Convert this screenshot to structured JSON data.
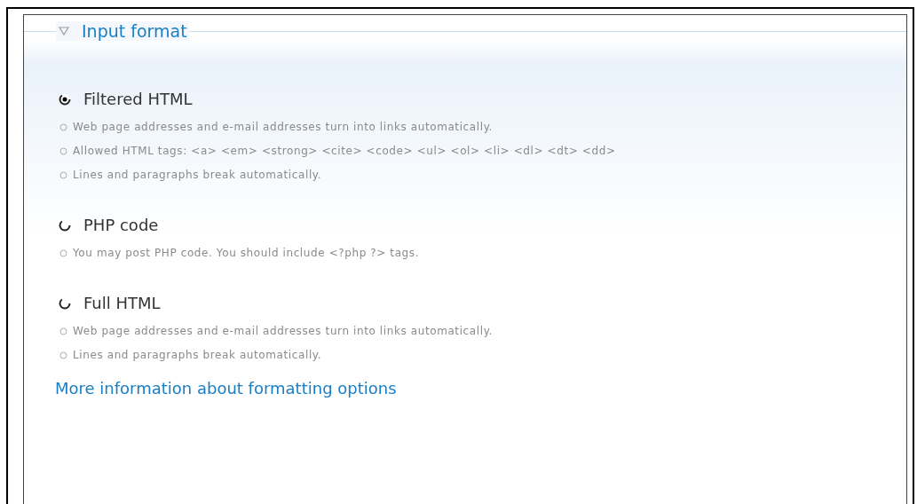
{
  "fieldset": {
    "legend": "Input format",
    "expanded": true
  },
  "formats": [
    {
      "label": "Filtered HTML",
      "selected": true,
      "tips": [
        "Web page addresses and e-mail addresses turn into links automatically.",
        "Allowed HTML tags: <a> <em> <strong> <cite> <code> <ul> <ol> <li> <dl> <dt> <dd>",
        "Lines and paragraphs break automatically."
      ]
    },
    {
      "label": "PHP code",
      "selected": false,
      "tips": [
        "You may post PHP code. You should include <?php ?> tags."
      ]
    },
    {
      "label": "Full HTML",
      "selected": false,
      "tips": [
        "Web page addresses and e-mail addresses turn into links automatically.",
        "Lines and paragraphs break automatically."
      ]
    }
  ],
  "link": "More information about formatting options"
}
